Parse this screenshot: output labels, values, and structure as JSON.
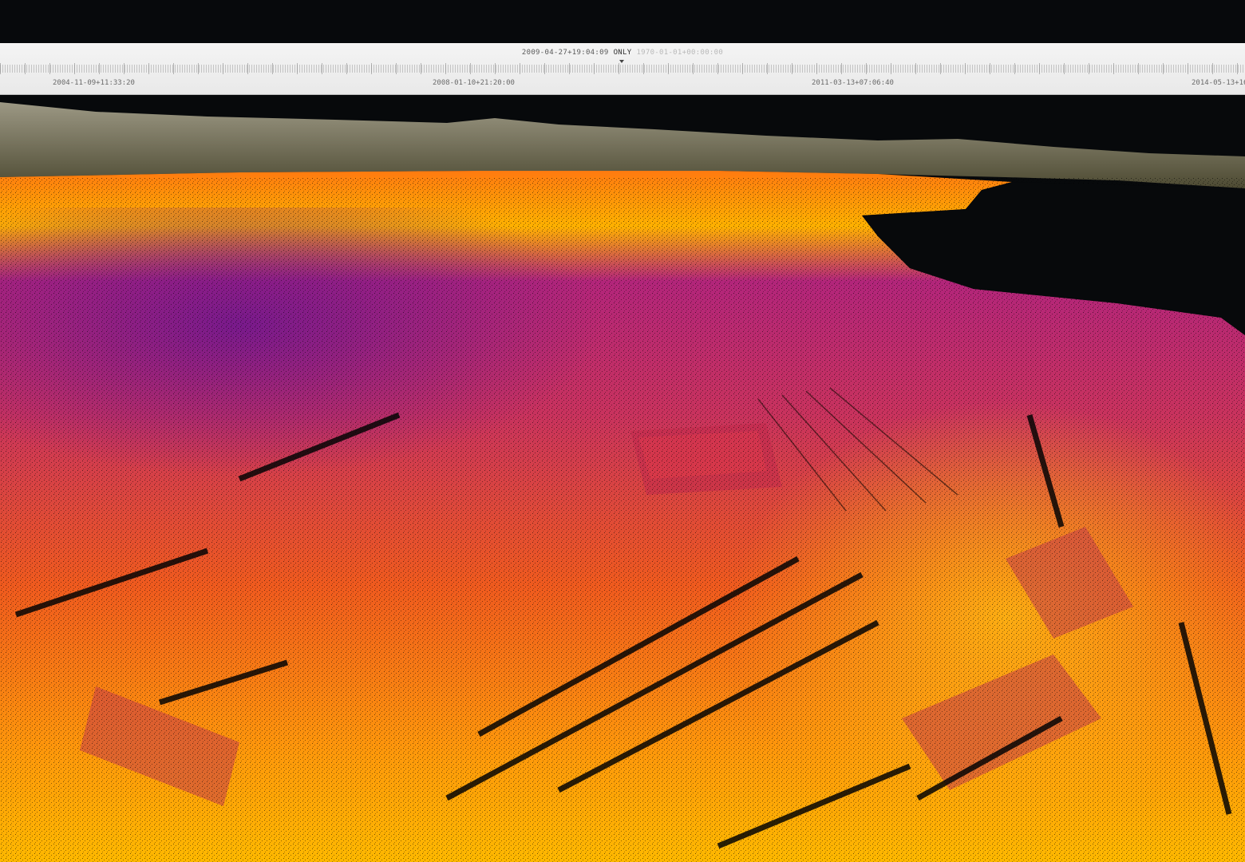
{
  "timeline": {
    "selected_time": "2009-04-27+19:04:09",
    "mode": "ONLY",
    "secondary_time": "1970-01-01+00:00:00",
    "axis_labels": [
      "2004-11-09+11:33:20",
      "2008-01-10+21:20:00",
      "2011-03-13+07:06:40",
      "2014-05-13+16"
    ]
  },
  "viewport": {
    "kind": "lidar point cloud, elevation colour ramp",
    "palette": [
      "#5b0f7a",
      "#8b1a8a",
      "#c8325e",
      "#ef5a1e",
      "#ff8a0c",
      "#ffb000",
      "#ffd23a"
    ],
    "background": "#07090b",
    "distant_hills": "#6f6c4e"
  }
}
